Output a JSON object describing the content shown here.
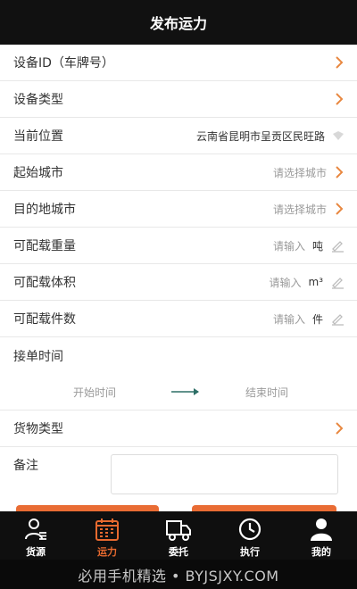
{
  "header": {
    "title": "发布运力"
  },
  "form": {
    "device_id": {
      "label": "设备ID（车牌号）"
    },
    "device_type": {
      "label": "设备类型"
    },
    "location": {
      "label": "当前位置",
      "value": "云南省昆明市呈贡区民旺路"
    },
    "origin_city": {
      "label": "起始城市",
      "placeholder": "请选择城市"
    },
    "dest_city": {
      "label": "目的地城市",
      "placeholder": "请选择城市"
    },
    "weight": {
      "label": "可配载重量",
      "placeholder": "请输入",
      "unit": "吨"
    },
    "volume": {
      "label": "可配载体积",
      "placeholder": "请输入",
      "unit": "m³"
    },
    "pieces": {
      "label": "可配载件数",
      "placeholder": "请输入",
      "unit": "件"
    },
    "order_time": {
      "label": "接单时间",
      "start_placeholder": "开始时间",
      "end_placeholder": "结束时间"
    },
    "cargo_type": {
      "label": "货物类型"
    },
    "notes": {
      "label": "备注",
      "value": ""
    }
  },
  "tabbar": {
    "active": "运力",
    "accent": "#e86a2f",
    "items": [
      {
        "label": "货源",
        "icon": "user-list-icon"
      },
      {
        "label": "运力",
        "icon": "calendar-icon"
      },
      {
        "label": "委托",
        "icon": "truck-icon"
      },
      {
        "label": "执行",
        "icon": "clock-icon"
      },
      {
        "label": "我的",
        "icon": "person-icon"
      }
    ]
  },
  "watermark": {
    "text": "必用手机精选 • BYJSJXY.COM"
  }
}
